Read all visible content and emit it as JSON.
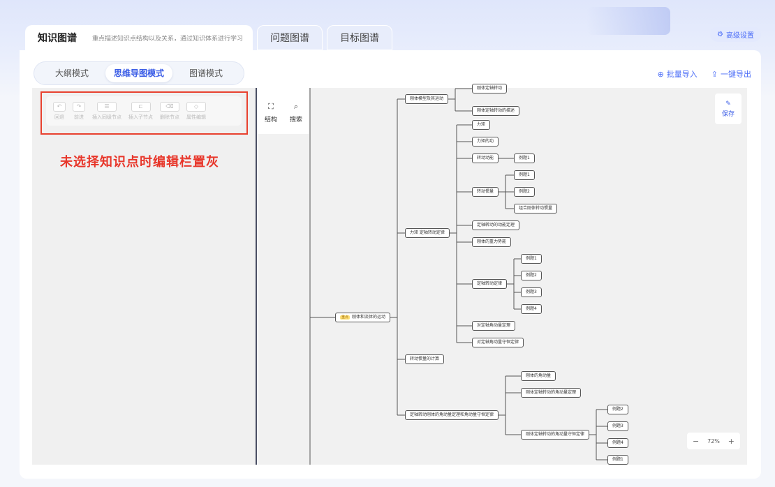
{
  "top_tabs": [
    {
      "label": "知识图谱",
      "desc": "重点描述知识点结构以及关系，通过知识体系进行学习"
    },
    {
      "label": "问题图谱"
    },
    {
      "label": "目标图谱"
    }
  ],
  "advanced_settings": "高级设置",
  "mode_tabs": [
    "大纲模式",
    "思维导图模式",
    "图谱模式"
  ],
  "actions": {
    "batch_import": "批量导入",
    "export": "一键导出"
  },
  "toolbar": [
    {
      "icon": "undo-icon",
      "label": "回退"
    },
    {
      "icon": "redo-icon",
      "label": "前进"
    },
    {
      "icon": "sibling-node-icon",
      "label": "插入同级节点"
    },
    {
      "icon": "child-node-icon",
      "label": "插入子节点"
    },
    {
      "icon": "delete-icon",
      "label": "删除节点"
    },
    {
      "icon": "tag-icon",
      "label": "属性编辑"
    }
  ],
  "annotation": "未选择知识点时编辑栏置灰",
  "side_tools": {
    "structure": "结构",
    "search": "搜索"
  },
  "save": "保存",
  "zoom": {
    "minus": "−",
    "level": "72%",
    "plus": "+"
  },
  "mindmap": {
    "root": {
      "tag": "重点",
      "label": "刚体和流体的运动"
    },
    "nodes": {
      "n_top": "刚体定轴转动",
      "n_model": "刚体模型及其运动",
      "n_model_c1": "刚体定轴转动的描述",
      "n_torque": "力矩 定轴转动定律",
      "n_t1": "力矩",
      "n_t2": "力矩的功",
      "n_t3": "转动动能",
      "n_t3e": "例题1",
      "n_t4": "转动惯量",
      "n_t4e1": "例题1",
      "n_t4e2": "例题2",
      "n_t4e3": "组合刚体转动惯量",
      "n_t5": "定轴转动的动能定理",
      "n_t6": "刚体的重力势能",
      "n_t7": "定轴转动定律",
      "n_t7e1": "例题1",
      "n_t7e2": "例题2",
      "n_t7e3": "例题3",
      "n_t7e4": "例题4",
      "n_t8": "对定轴角动量定理",
      "n_t9": "对定轴角动量守恒定律",
      "n_inertia": "转动惯量的计算",
      "n_am": "定轴转动刚体的角动量定理和角动量守恒定律",
      "n_am1": "刚体的角动量",
      "n_am2": "刚体定轴转动的角动量定理",
      "n_am3": "刚体定轴转动的角动量守恒定律",
      "n_am3e1": "例题2",
      "n_am3e2": "例题3",
      "n_am3e3": "例题4",
      "n_am3e4": "例题1"
    }
  }
}
